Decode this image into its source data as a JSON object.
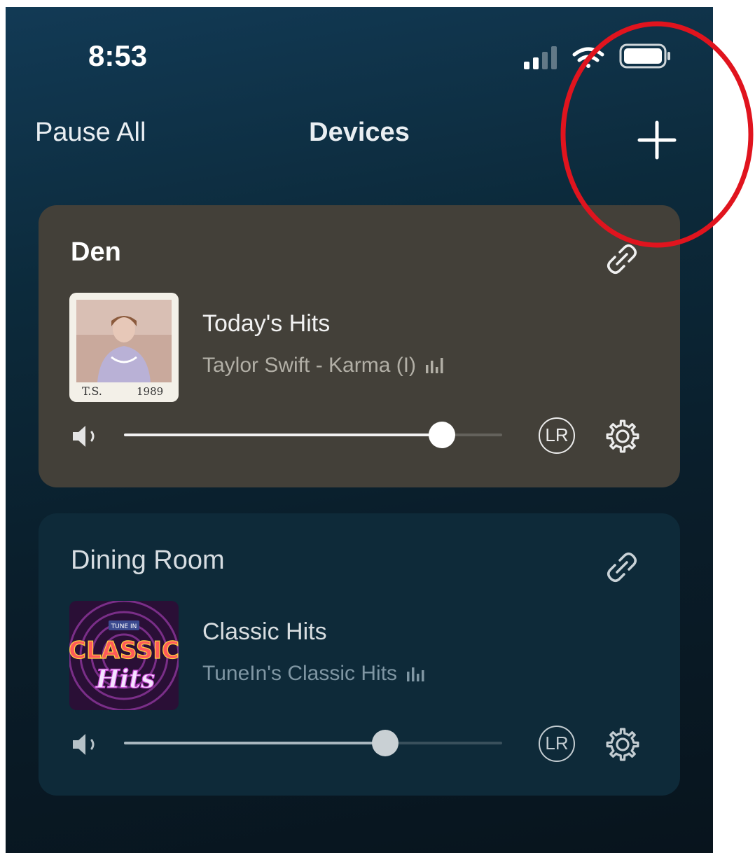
{
  "status_bar": {
    "time": "8:53",
    "icons": [
      "cellular-signal-icon",
      "wifi-icon",
      "battery-icon"
    ]
  },
  "nav": {
    "left_label": "Pause All",
    "title": "Devices",
    "right_icon": "plus-icon"
  },
  "devices": [
    {
      "name": "Den",
      "station": "Today's Hits",
      "now_playing": "Taylor Swift - Karma (I)",
      "volume_percent": 84,
      "lr_label": "LR",
      "album_art_text_left": "T.S.",
      "album_art_text_right": "1989"
    },
    {
      "name": "Dining Room",
      "station": "Classic Hits",
      "now_playing": "TuneIn's Classic Hits",
      "volume_percent": 69,
      "lr_label": "LR",
      "album_art_badge": "TUNE IN",
      "album_art_title": "CLASSIC",
      "album_art_subtitle": "Hits"
    }
  ],
  "colors": {
    "background_top": "#123a55",
    "background_bottom": "#08141d",
    "den_card": "#434039",
    "dining_card": "#0e2a39",
    "annotation_red": "#e0141e"
  }
}
